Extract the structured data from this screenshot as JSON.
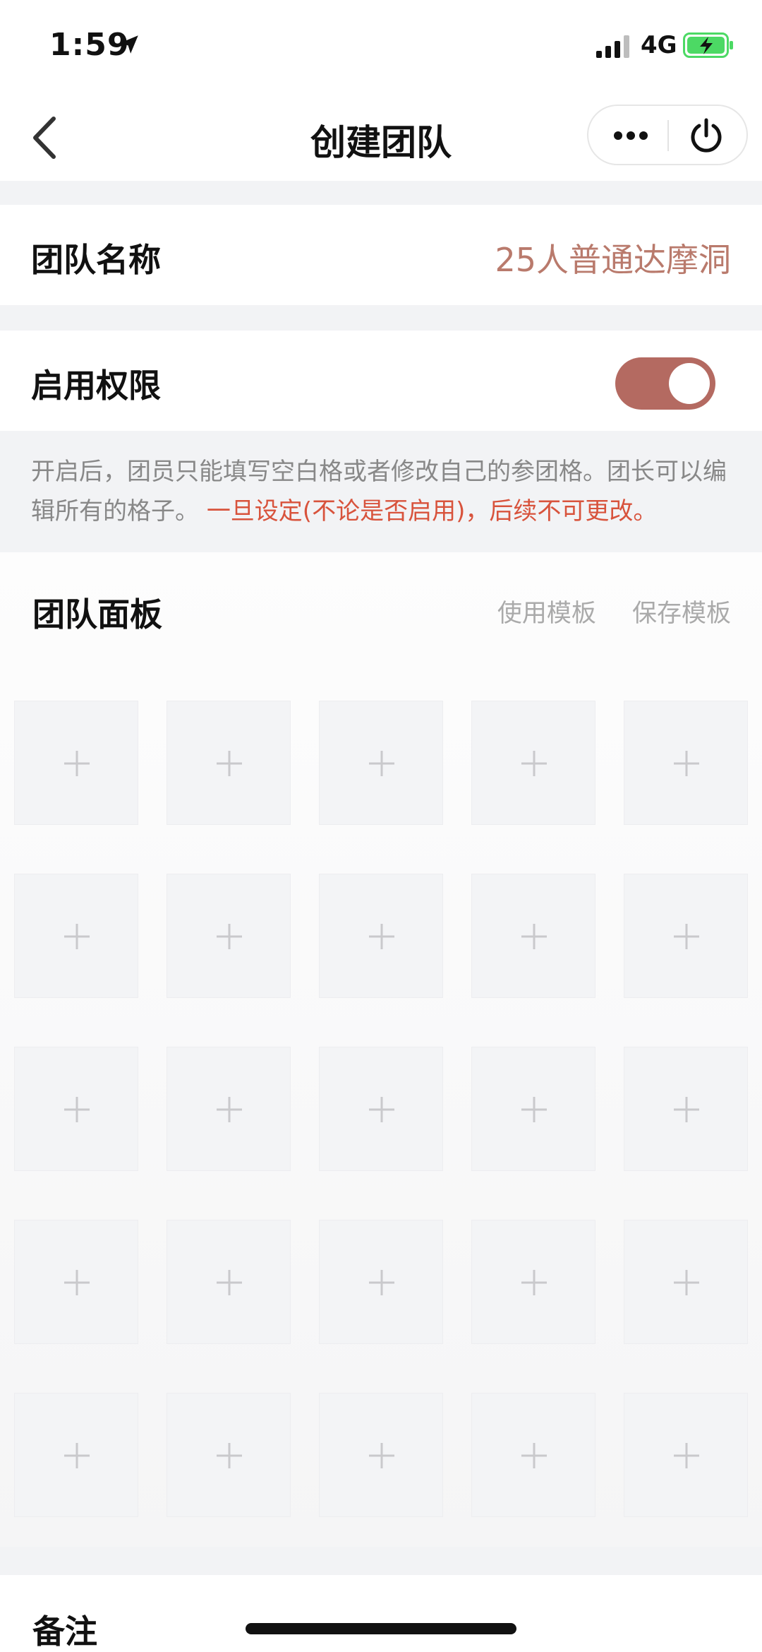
{
  "status_bar": {
    "time": "1:59",
    "network": "4G",
    "icons": [
      "location-arrow-icon",
      "signal-bars-icon",
      "battery-charging-icon"
    ],
    "battery_color": "#4cd964"
  },
  "nav": {
    "title": "创建团队",
    "icons": [
      "back-chevron-icon",
      "more-dots-icon",
      "power-icon"
    ]
  },
  "team_name": {
    "label": "团队名称",
    "value": "25人普通达摩洞",
    "value_color": "#b97a6c"
  },
  "permission": {
    "label": "启用权限",
    "enabled": true,
    "toggle_color": "#b46a61"
  },
  "hint": {
    "text": "开启后，团员只能填写空白格或者修改自己的参团格。团长可以编辑所有的格子。",
    "warning": "一旦设定(不论是否启用)，后续不可更改。",
    "warning_color": "#d8533c"
  },
  "panel": {
    "title": "团队面板",
    "use_template": "使用模板",
    "save_template": "保存模板",
    "rows": 5,
    "columns": 5,
    "slot_icon": "plus-icon"
  },
  "notes": {
    "label": "备注"
  }
}
